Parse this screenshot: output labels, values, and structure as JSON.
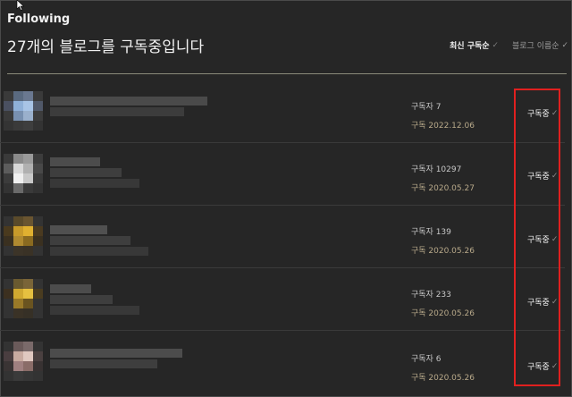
{
  "header": {
    "section_title": "Following",
    "headline": "27개의 블로그를 구독중입니다",
    "sort_options": [
      {
        "label": "최신 구독순",
        "active": true
      },
      {
        "label": "블로그 이름순",
        "active": false
      }
    ]
  },
  "colors": {
    "background": "#262626",
    "highlight_box": "#e0201f",
    "date_text": "#b8a98a"
  },
  "subscriptions": [
    {
      "subscribers": "구독자 7",
      "date": "구독 2022.12.06",
      "button": "구독중"
    },
    {
      "subscribers": "구독자 10297",
      "date": "구독 2020.05.27",
      "button": "구독중"
    },
    {
      "subscribers": "구독자 139",
      "date": "구독 2020.05.26",
      "button": "구독중"
    },
    {
      "subscribers": "구독자 233",
      "date": "구독 2020.05.26",
      "button": "구독중"
    },
    {
      "subscribers": "구독자 6",
      "date": "구독 2020.05.26",
      "button": "구독중"
    }
  ]
}
